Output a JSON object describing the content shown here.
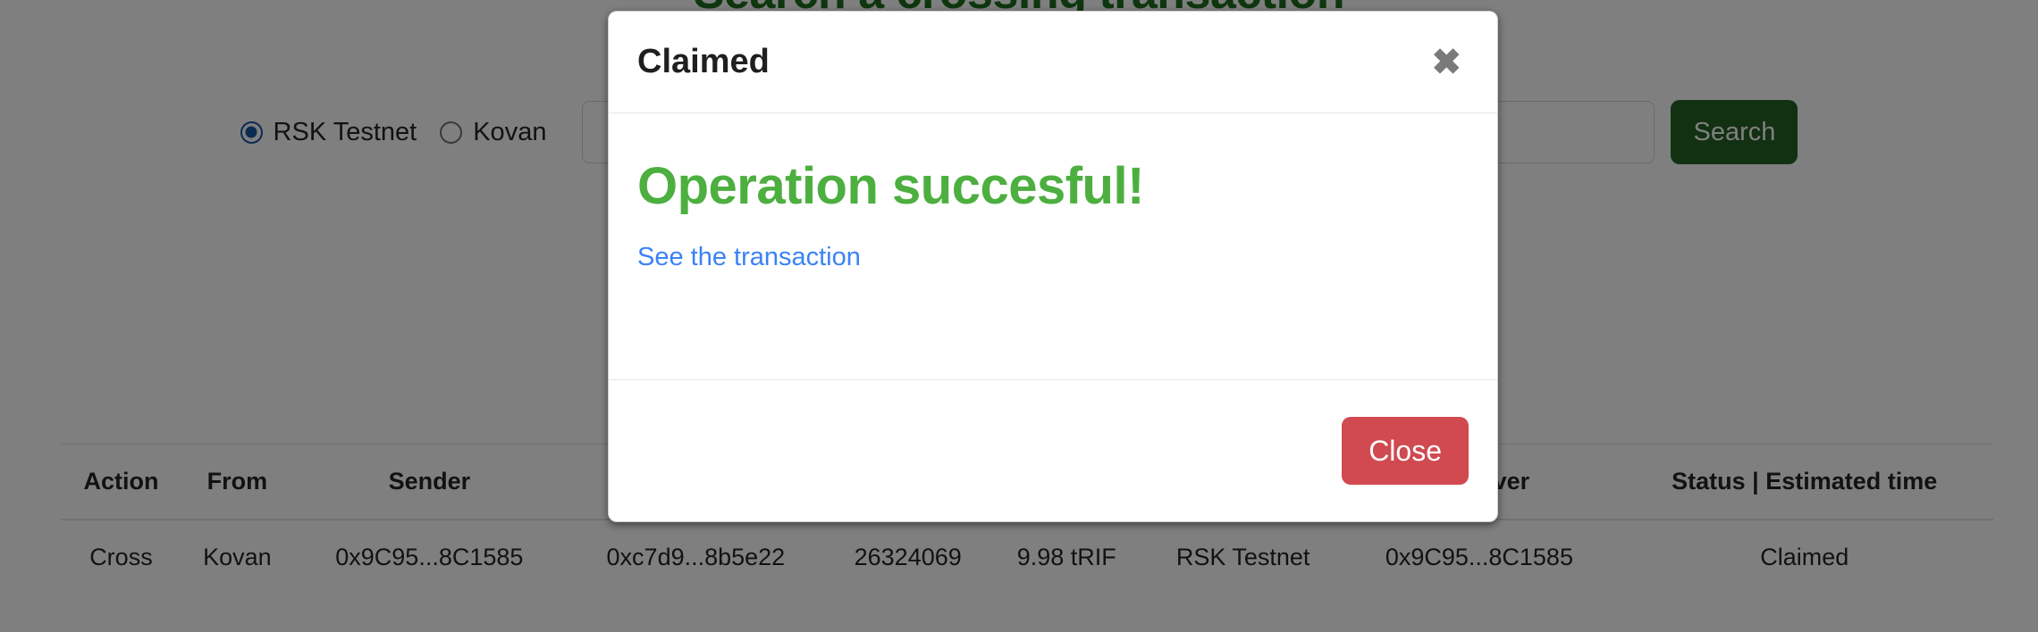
{
  "page": {
    "title": "Search a crossing transaction"
  },
  "search": {
    "networks": [
      {
        "label": "RSK Testnet",
        "selected": true
      },
      {
        "label": "Kovan",
        "selected": false
      }
    ],
    "input_value": "",
    "input_placeholder": "",
    "button_label": "Search"
  },
  "table": {
    "headers": [
      "Action",
      "From",
      "Sender",
      "",
      "",
      "",
      "",
      "Receiver",
      "Status | Estimated time"
    ],
    "rows": [
      {
        "action": "Cross",
        "from": "Kovan",
        "sender": "0x9C95...8C1585",
        "hash": "0xc7d9...8b5e22",
        "block": "26324069",
        "amount": "9.98 tRIF",
        "to": "RSK Testnet",
        "receiver": "0x9C95...8C1585",
        "status": "Claimed"
      }
    ]
  },
  "modal": {
    "title": "Claimed",
    "close_icon": "✖",
    "message": "Operation succesful!",
    "link_label": "See the transaction",
    "close_button_label": "Close"
  },
  "colors": {
    "brand_green": "#1f6f1f",
    "success_green": "#4caf3f",
    "link_blue": "#1857a4",
    "modal_link_blue": "#3b82f6",
    "danger_red": "#d04a50",
    "status_green": "#1f7a1f"
  }
}
